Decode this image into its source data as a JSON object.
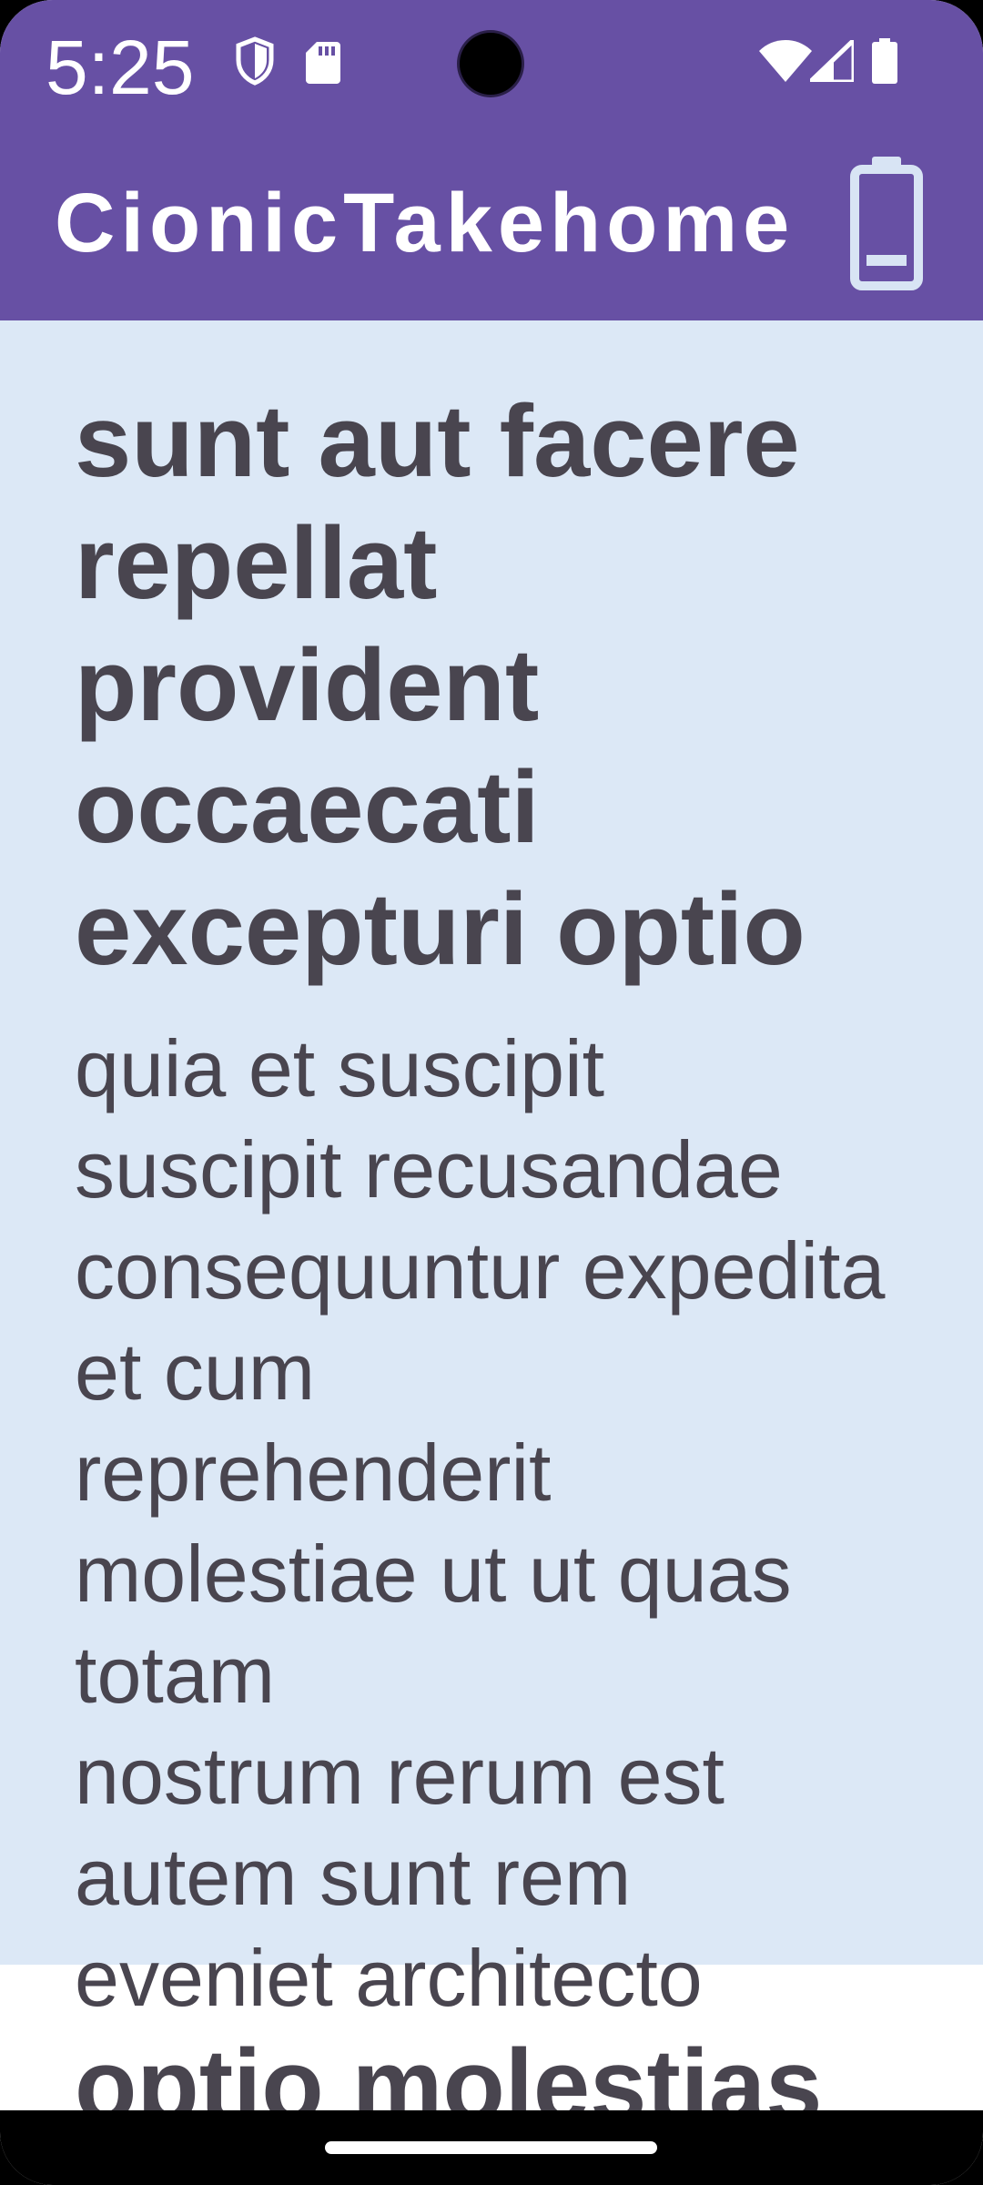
{
  "status_bar": {
    "time": "5:25",
    "icons": [
      "shield-icon",
      "sd-card-icon",
      "wifi-icon",
      "signal-icon",
      "battery-icon"
    ]
  },
  "app_bar": {
    "title": "CionicTakehome",
    "action_icon": "battery-outline-icon"
  },
  "posts": [
    {
      "title": "sunt aut facere repellat provident occaecati excepturi optio",
      "body": "quia et suscipit\nsuscipit recusandae consequuntur expedita et cum\nreprehenderit molestiae ut ut quas totam\nnostrum rerum est autem sunt rem eveniet architecto"
    },
    {
      "title": "optio molestias",
      "body": ""
    }
  ],
  "colors": {
    "primary": "#6750a4",
    "selected_background": "#dce8f6",
    "text": "#49454f",
    "on_primary": "#ffffff",
    "battery_icon": "#d8e4f4"
  }
}
